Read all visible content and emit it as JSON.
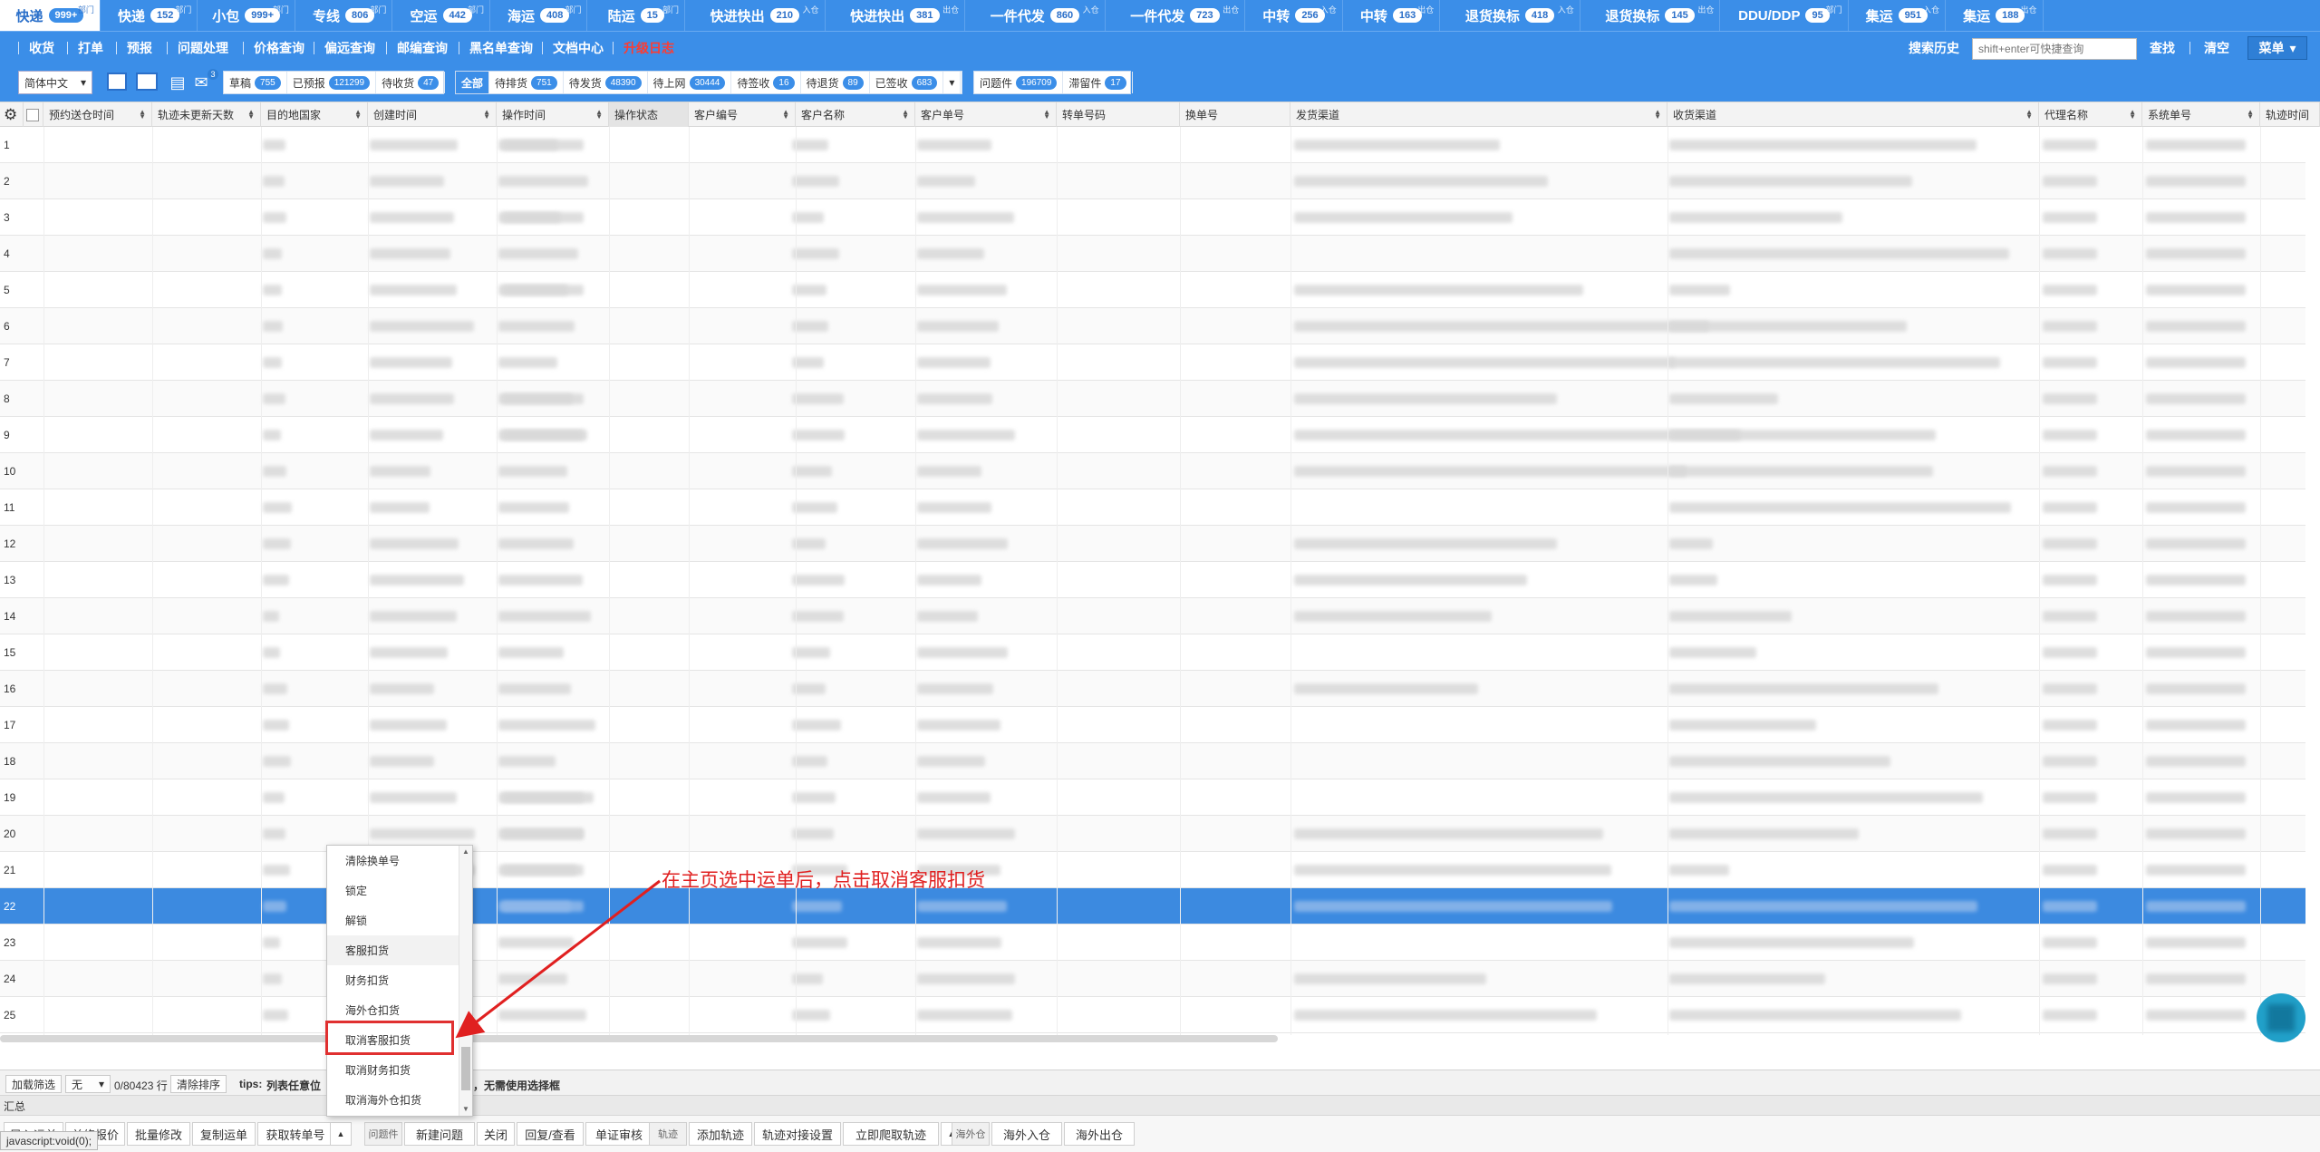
{
  "tabs": [
    {
      "label": "快递",
      "count": "999+",
      "active": true,
      "sup": "部门"
    },
    {
      "label": "快递",
      "count": "152",
      "sup": "部门"
    },
    {
      "label": "小包",
      "count": "999+",
      "sup": "部门"
    },
    {
      "label": "专线",
      "count": "806",
      "sup": "部门"
    },
    {
      "label": "空运",
      "count": "442",
      "sup": "部门"
    },
    {
      "label": "海运",
      "count": "408",
      "sup": "部门"
    },
    {
      "label": "陆运",
      "count": "15",
      "sup": "部门"
    },
    {
      "label": "快进快出",
      "count": "210",
      "sup": "入仓"
    },
    {
      "label": "快进快出",
      "count": "381",
      "sup": "出仓"
    },
    {
      "label": "一件代发",
      "count": "860",
      "sup": "入仓"
    },
    {
      "label": "一件代发",
      "count": "723",
      "sup": "出仓"
    },
    {
      "label": "中转",
      "count": "256",
      "sup": "入仓"
    },
    {
      "label": "中转",
      "count": "163",
      "sup": "出仓"
    },
    {
      "label": "退货换标",
      "count": "418",
      "sup": "入仓"
    },
    {
      "label": "退货换标",
      "count": "145",
      "sup": "出仓"
    },
    {
      "label": "DDU/DDP",
      "count": "95",
      "sup": "部门"
    },
    {
      "label": "集运",
      "count": "951",
      "sup": "入仓"
    },
    {
      "label": "集运",
      "count": "188",
      "sup": "出仓"
    }
  ],
  "menu": {
    "items": [
      "收货",
      "打单",
      "预报",
      "问题处理",
      "价格查询",
      "偏远查询",
      "邮编查询",
      "黑名单查询",
      "文档中心"
    ],
    "upgrade_log": "升级日志",
    "search_history": "搜索历史",
    "search_placeholder": "shift+enter可快捷查询",
    "search_button": "查找",
    "clear_button": "清空",
    "main_menu": "菜单"
  },
  "filters": {
    "language": "简体中文",
    "mail_badge": "3",
    "group1": [
      {
        "label": "草稿",
        "count": "755"
      },
      {
        "label": "已预报",
        "count": "121299"
      },
      {
        "label": "待收货",
        "count": "47"
      }
    ],
    "group2": [
      {
        "label": "全部",
        "selected": true
      },
      {
        "label": "待排货",
        "count": "751"
      },
      {
        "label": "待发货",
        "count": "48390"
      },
      {
        "label": "待上网",
        "count": "30444"
      },
      {
        "label": "待签收",
        "count": "16"
      },
      {
        "label": "待退货",
        "count": "89"
      },
      {
        "label": "已签收",
        "count": "683"
      }
    ],
    "group3": [
      {
        "label": "问题件",
        "count": "196709"
      },
      {
        "label": "滞留件",
        "count": "17"
      }
    ]
  },
  "columns": [
    "预约送仓时间",
    "轨迹未更新天数",
    "目的地国家",
    "创建时间",
    "操作时间",
    "操作状态",
    "客户编号",
    "客户名称",
    "客户单号",
    "转单号码",
    "换单号",
    "发货渠道",
    "收货渠道",
    "代理名称",
    "系统单号",
    "轨迹时间"
  ],
  "rows": [
    "1",
    "2",
    "3",
    "4",
    "5",
    "6",
    "7",
    "8",
    "9",
    "10",
    "11",
    "12",
    "13",
    "14",
    "15",
    "16",
    "17",
    "18",
    "19",
    "20",
    "21",
    "22",
    "23",
    "24",
    "25"
  ],
  "selected_row": "22",
  "context_menu": {
    "items": [
      "清除换单号",
      "锁定",
      "解锁",
      "客服扣货",
      "财务扣货",
      "海外仓扣货",
      "取消客服扣货",
      "取消财务扣货",
      "取消海外仓扣货"
    ],
    "highlighted": "取消客服扣货"
  },
  "annotation": "在主页选中运单后，点击取消客服扣货",
  "footer": {
    "load_filter": "加载筛选",
    "filter_value": "无",
    "row_count": "0/80423 行",
    "clear_sort": "清除排序",
    "tips_label": "tips:",
    "tips_text": "列表任意位",
    "tips_tail": "，无需使用选择框",
    "summary": "汇总",
    "url": "javascript:void(0);",
    "buttons_left": [
      "导入运单",
      "单修报价",
      "批量修改",
      "复制运单",
      "获取转单号"
    ],
    "group_problem_label": "问题件",
    "buttons_problem": [
      "新建问题",
      "关闭",
      "回复/查看",
      "单证审核"
    ],
    "group_track_label": "轨迹",
    "buttons_track": [
      "添加轨迹",
      "轨迹对接设置",
      "立即爬取轨迹"
    ],
    "group_overseas_label": "海外仓",
    "buttons_overseas": [
      "海外入仓",
      "海外出仓"
    ]
  }
}
